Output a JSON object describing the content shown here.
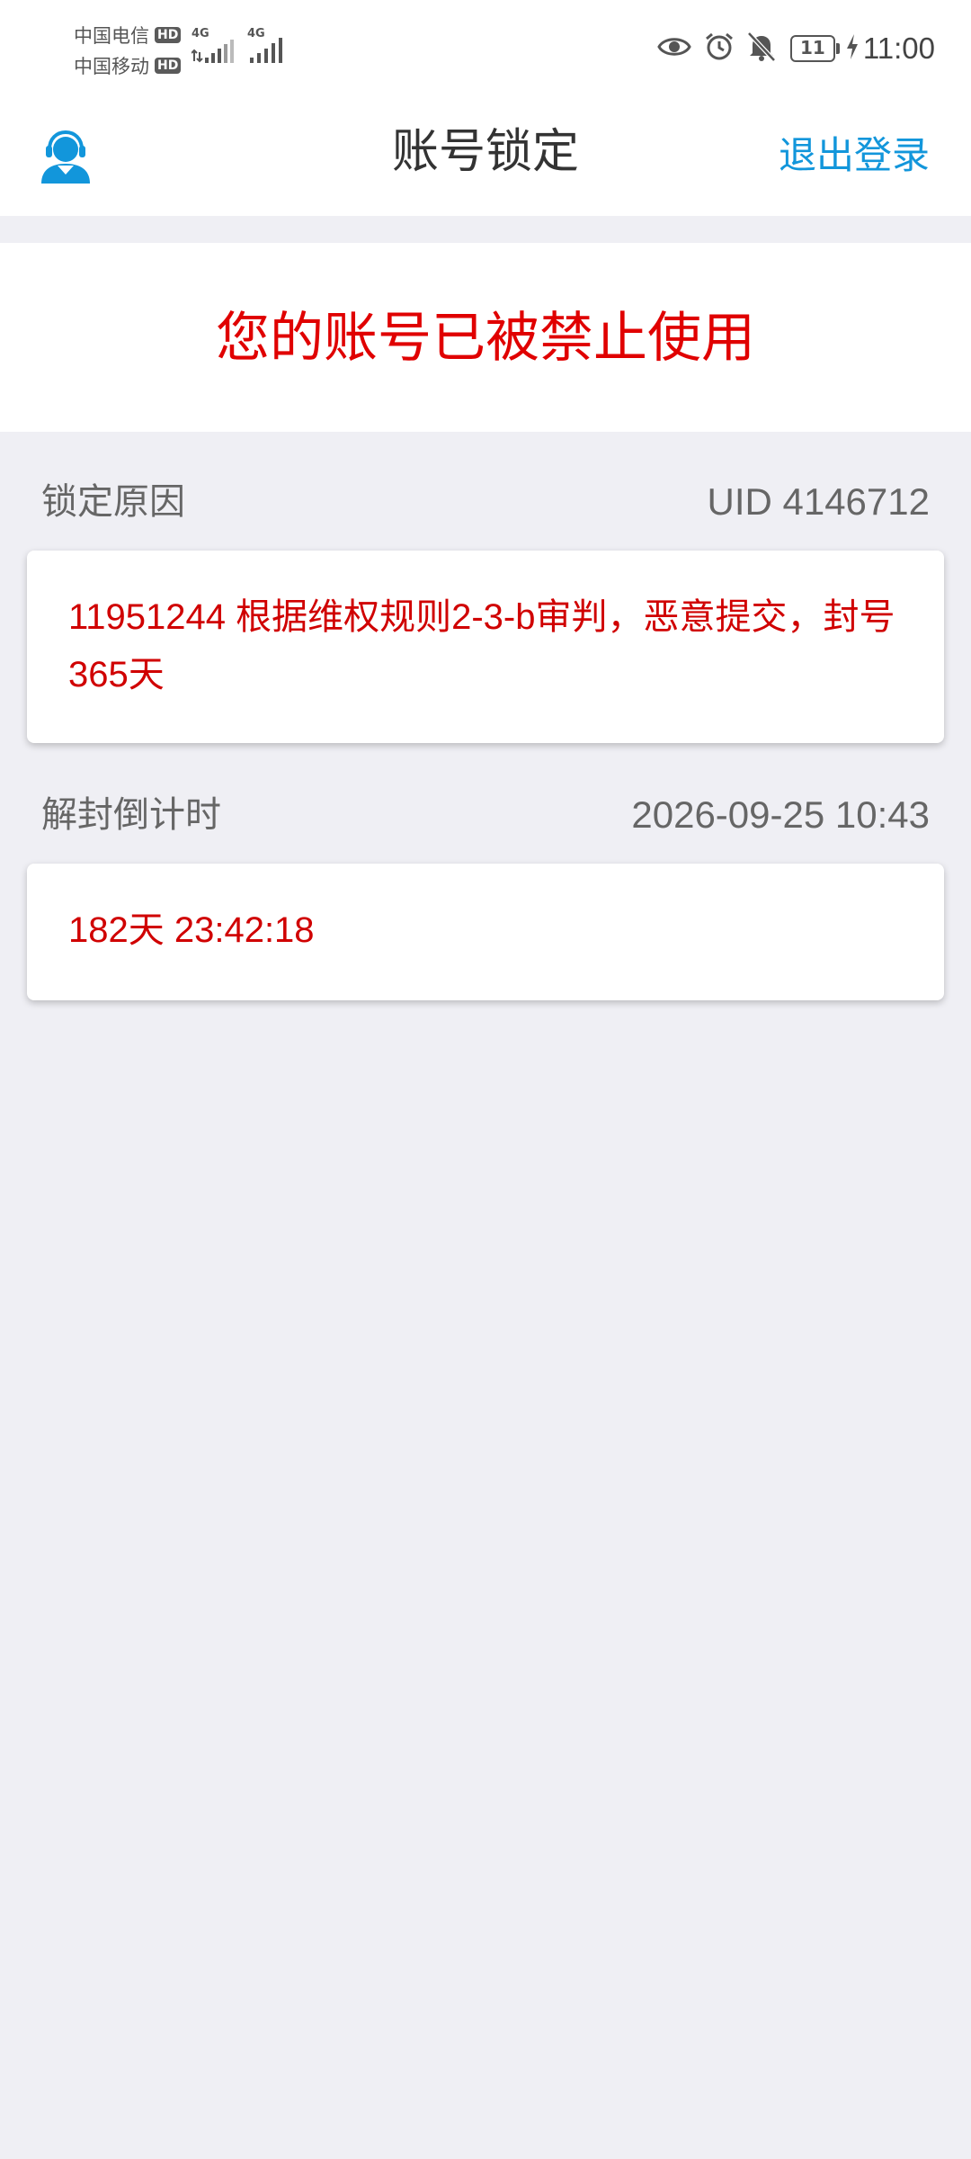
{
  "status_bar": {
    "carrier1": "中国电信",
    "carrier2": "中国移动",
    "hd_label": "HD",
    "net_type": "4G",
    "battery_level": "11",
    "time": "11:00",
    "icons": [
      "eye-icon",
      "alarm-clock-icon",
      "bell-off-icon",
      "charging-icon"
    ]
  },
  "header": {
    "title": "账号锁定",
    "logout_label": "退出登录",
    "support_icon": "customer-service-icon",
    "accent_color": "#1296db"
  },
  "banner": {
    "message": "您的账号已被禁止使用",
    "color": "#e00000"
  },
  "lock_reason": {
    "label": "锁定原因",
    "uid": "UID 4146712",
    "text": "11951244 根据维权规则2-3-b审判，恶意提交，封号365天"
  },
  "countdown": {
    "label": "解封倒计时",
    "unlock_time": "2026-09-25 10:43",
    "remaining": "182天 23:42:18"
  }
}
